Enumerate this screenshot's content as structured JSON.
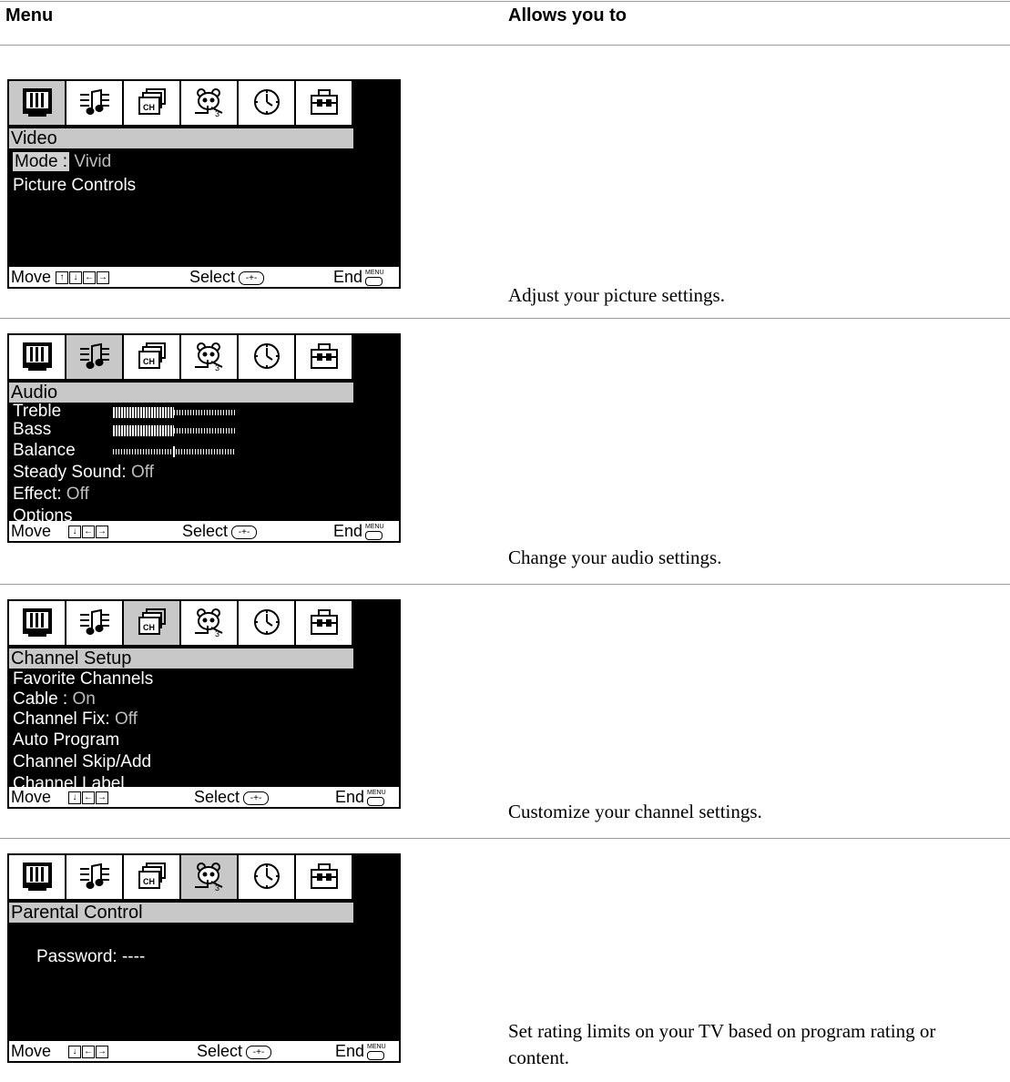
{
  "header": {
    "menu_col": "Menu",
    "allows_col": "Allows you to"
  },
  "footer_labels": {
    "move": "Move",
    "select": "Select",
    "end": "End",
    "menu_key": "MENU",
    "select_key": "-+-"
  },
  "icon_names": [
    "tv-picture-icon",
    "audio-note-icon",
    "channel-icon",
    "parental-bear-icon",
    "clock-icon",
    "setup-toolbox-icon"
  ],
  "rows": [
    {
      "title": "Video",
      "mode_label": "Mode :",
      "mode_value": "Vivid",
      "line2": "Picture Controls",
      "description": "Adjust your picture settings."
    },
    {
      "title": "Audio",
      "treble": "Treble",
      "bass": "Bass",
      "balance": "Balance",
      "steady_label": "Steady Sound:",
      "steady_value": "Off",
      "effect_label": "Effect:",
      "effect_value": "Off",
      "options": "Options",
      "treble_level": 0.5,
      "bass_level": 0.5,
      "balance_level": 0.5,
      "description": "Change your audio settings."
    },
    {
      "title": "Channel Setup",
      "favorites": "Favorite Channels",
      "cable_label": "Cable :",
      "cable_value": "On",
      "fix_label": "Channel Fix:",
      "fix_value": "Off",
      "auto": "Auto Program",
      "skip": "Channel Skip/Add",
      "label": "Channel Label",
      "description": "Customize your channel settings."
    },
    {
      "title": "Parental Control",
      "password": "Password: ----",
      "description": "Set rating limits on your TV based on program rating or content."
    }
  ]
}
